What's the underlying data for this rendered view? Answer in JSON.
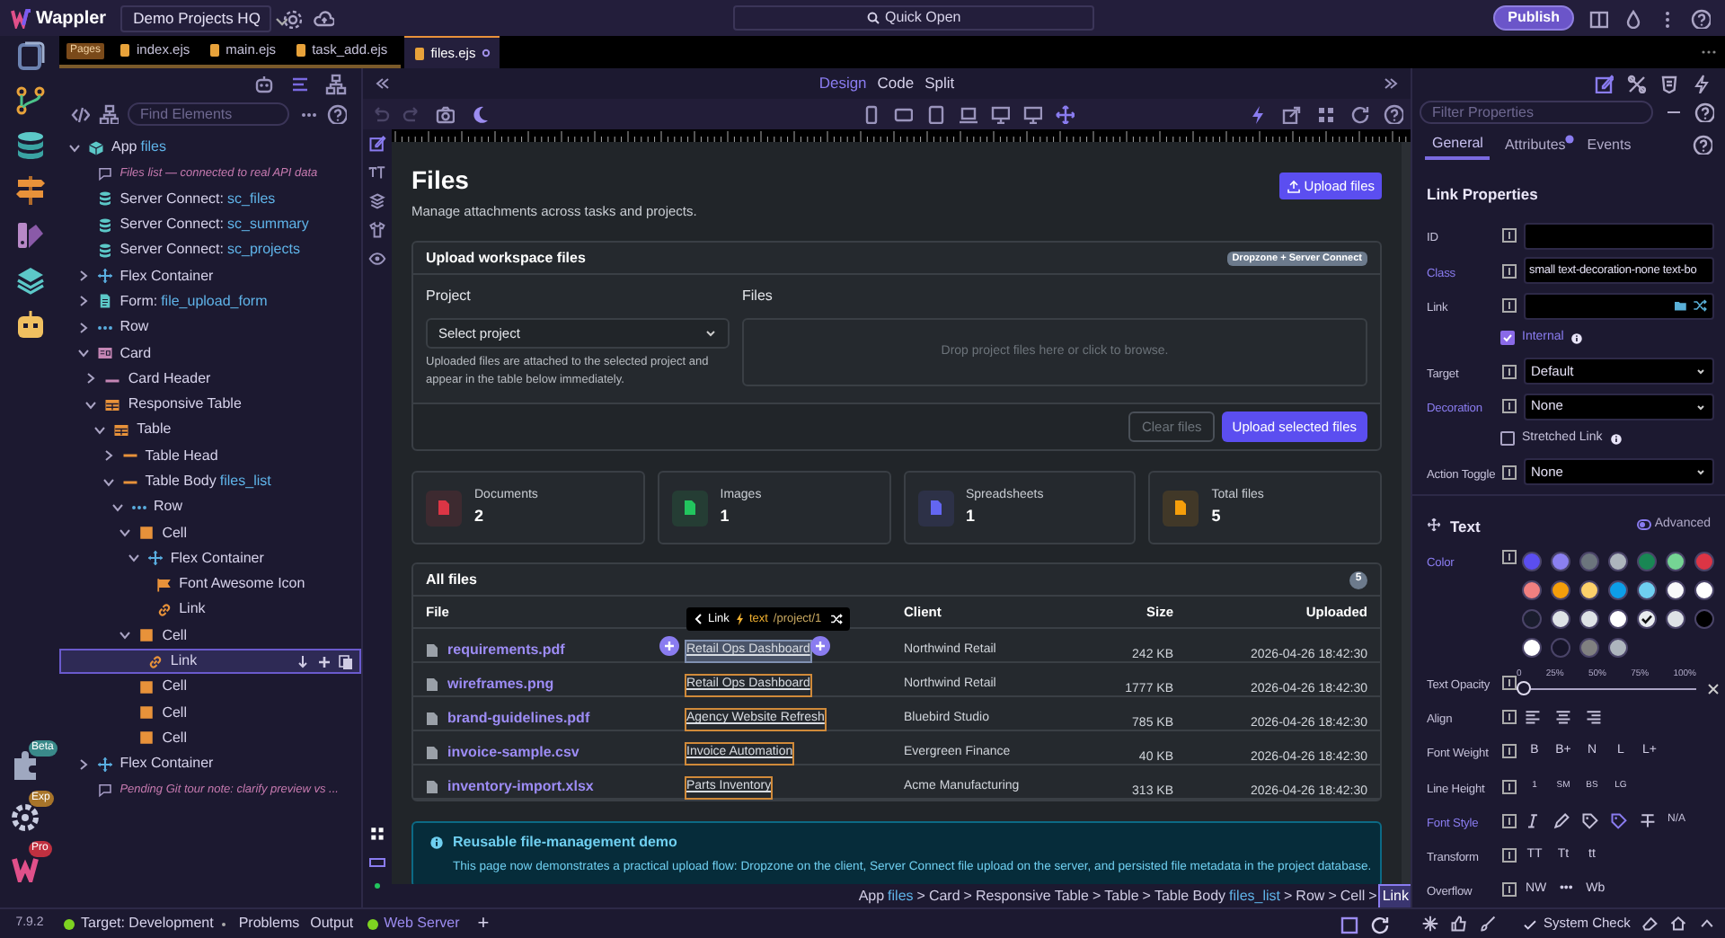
{
  "top_bar": {
    "app_name": "Wappler",
    "project": "Demo Projects HQ",
    "quick_open": "Quick Open",
    "publish": "Publish"
  },
  "file_tabs": {
    "pages_badge": "Pages",
    "tabs": [
      {
        "label": "index.ejs",
        "selected": false,
        "modified": false
      },
      {
        "label": "main.ejs",
        "selected": false,
        "modified": false
      },
      {
        "label": "task_add.ejs",
        "selected": false,
        "modified": false
      },
      {
        "label": "files.ejs",
        "selected": true,
        "modified": true
      }
    ]
  },
  "rail_badges": [
    "Beta",
    "Exp",
    "Pro"
  ],
  "structure": {
    "search": {
      "placeholder": "Find Elements"
    },
    "tree": [
      {
        "kind": "app",
        "label": "App",
        "ref": "files",
        "expanded": true,
        "selected": false,
        "children": [
          {
            "kind": "comment",
            "label": "Files list — connected to real API data",
            "selected": false
          },
          {
            "kind": "server",
            "label": "Server Connect:",
            "ref": "sc_files",
            "selected": false
          },
          {
            "kind": "server",
            "label": "Server Connect:",
            "ref": "sc_summary",
            "selected": false
          },
          {
            "kind": "server",
            "label": "Server Connect:",
            "ref": "sc_projects",
            "selected": false
          },
          {
            "kind": "flex",
            "label": "Flex Container",
            "expanded": false,
            "selected": false
          },
          {
            "kind": "form",
            "label": "Form:",
            "ref": "file_upload_form",
            "expanded": false,
            "selected": false
          },
          {
            "kind": "row",
            "label": "Row",
            "expanded": false,
            "selected": false
          },
          {
            "kind": "card",
            "label": "Card",
            "expanded": true,
            "selected": false,
            "children": [
              {
                "kind": "card-header",
                "label": "Card Header",
                "expanded": false,
                "selected": false
              },
              {
                "kind": "table",
                "label": "Responsive Table",
                "expanded": true,
                "selected": false,
                "children": [
                  {
                    "kind": "table",
                    "label": "Table",
                    "expanded": true,
                    "selected": false,
                    "children": [
                      {
                        "kind": "table-part",
                        "label": "Table Head",
                        "expanded": false,
                        "selected": false
                      },
                      {
                        "kind": "table-part",
                        "label": "Table Body",
                        "ref": "files_list",
                        "expanded": true,
                        "selected": false,
                        "children": [
                          {
                            "kind": "row",
                            "label": "Row",
                            "expanded": true,
                            "selected": false,
                            "children": [
                              {
                                "kind": "cell",
                                "label": "Cell",
                                "expanded": true,
                                "selected": false,
                                "children": [
                                  {
                                    "kind": "flex",
                                    "label": "Flex Container",
                                    "expanded": true,
                                    "selected": false,
                                    "children": [
                                      {
                                        "kind": "icon",
                                        "label": "Font Awesome Icon",
                                        "selected": false
                                      },
                                      {
                                        "kind": "link",
                                        "label": "Link",
                                        "selected": false
                                      }
                                    ]
                                  }
                                ]
                              },
                              {
                                "kind": "cell",
                                "label": "Cell",
                                "expanded": true,
                                "selected": false,
                                "children": [
                                  {
                                    "kind": "link",
                                    "label": "Link",
                                    "selected": true
                                  }
                                ]
                              },
                              {
                                "kind": "cell",
                                "label": "Cell",
                                "selected": false
                              },
                              {
                                "kind": "cell",
                                "label": "Cell",
                                "selected": false
                              },
                              {
                                "kind": "cell",
                                "label": "Cell",
                                "selected": false
                              }
                            ]
                          }
                        ]
                      }
                    ]
                  }
                ]
              }
            ]
          },
          {
            "kind": "flex",
            "label": "Flex Container",
            "expanded": false,
            "selected": false
          },
          {
            "kind": "comment",
            "label": "Pending Git tour note: clarify preview vs ...",
            "selected": false
          }
        ]
      }
    ]
  },
  "view_modes": [
    {
      "label": "Design",
      "selected": true
    },
    {
      "label": "Code",
      "selected": false
    },
    {
      "label": "Split",
      "selected": false
    }
  ],
  "page": {
    "title": "Files",
    "subtitle": "Manage attachments across tasks and projects.",
    "upload_button": "Upload files",
    "upload_card": {
      "title": "Upload workspace files",
      "badge": "Dropzone + Server Connect",
      "project_label": "Project",
      "project_select": "Select project",
      "help": "Uploaded files are attached to the selected project and appear in the table below immediately.",
      "files_label": "Files",
      "dropzone": "Drop project files here or click to browse.",
      "clear_button": "Clear files",
      "submit_button": "Upload selected files"
    },
    "stats": [
      {
        "label": "Documents",
        "value": "2",
        "color": "#dc3545"
      },
      {
        "label": "Images",
        "value": "1",
        "color": "#22c55e"
      },
      {
        "label": "Spreadsheets",
        "value": "1",
        "color": "#6366f1"
      },
      {
        "label": "Total files",
        "value": "5",
        "color": "#f59e0b"
      }
    ],
    "files_table": {
      "title": "All files",
      "count": "5",
      "columns": [
        "File",
        "",
        "Client",
        "Size",
        "Uploaded"
      ],
      "tooltip": {
        "label": "Link",
        "type": "text",
        "value": "/project/1"
      },
      "rows": [
        {
          "file": "requirements.pdf",
          "project": "Retail Ops Dashboard",
          "client": "Northwind Retail",
          "size": "242 KB",
          "uploaded": "2026-04-26 18:42:30",
          "selected": true
        },
        {
          "file": "wireframes.png",
          "project": "Retail Ops Dashboard",
          "client": "Northwind Retail",
          "size": "1777 KB",
          "uploaded": "2026-04-26 18:42:30",
          "selected": false
        },
        {
          "file": "brand-guidelines.pdf",
          "project": "Agency Website Refresh",
          "client": "Bluebird Studio",
          "size": "785 KB",
          "uploaded": "2026-04-26 18:42:30",
          "selected": false
        },
        {
          "file": "invoice-sample.csv",
          "project": "Invoice Automation",
          "client": "Evergreen Finance",
          "size": "40 KB",
          "uploaded": "2026-04-26 18:42:30",
          "selected": false
        },
        {
          "file": "inventory-import.xlsx",
          "project": "Parts Inventory",
          "client": "Acme Manufacturing",
          "size": "313 KB",
          "uploaded": "2026-04-26 18:42:30",
          "selected": false
        }
      ]
    },
    "alert": {
      "title": "Reusable file-management demo",
      "text": "This page now demonstrates a practical upload flow: Dropzone on the client, Server Connect file upload on the server, and persisted file metadata in the project database."
    }
  },
  "breadcrumb": [
    {
      "label": "App",
      "ref": "files",
      "selected": false
    },
    {
      "separator": ">",
      "label": "Card",
      "selected": false
    },
    {
      "separator": ">",
      "label": "Responsive Table",
      "selected": false
    },
    {
      "separator": ">",
      "label": "Table",
      "selected": false
    },
    {
      "separator": ">",
      "label": "Table Body",
      "ref": "files_list",
      "selected": false
    },
    {
      "separator": ">",
      "label": "Row",
      "selected": false
    },
    {
      "separator": ">",
      "label": "Cell",
      "selected": false
    },
    {
      "separator": ">",
      "label": "Link",
      "selected": true
    }
  ],
  "properties": {
    "filter": {
      "placeholder": "Filter Properties"
    },
    "tabs": [
      {
        "label": "General",
        "selected": true,
        "dot": false
      },
      {
        "label": "Attributes",
        "selected": false,
        "dot": true
      },
      {
        "label": "Events",
        "selected": false,
        "dot": false
      }
    ],
    "title": "Link Properties",
    "rows": [
      {
        "kind": "input",
        "label": "ID",
        "highlighted": false
      },
      {
        "kind": "input",
        "label": "Class",
        "value": "small text-decoration-none text-bo",
        "highlighted": true
      },
      {
        "kind": "link",
        "label": "Link",
        "highlighted": false
      },
      {
        "kind": "checkbox",
        "label": "Internal",
        "checked": true
      },
      {
        "kind": "select",
        "label": "Target",
        "value": "Default",
        "highlighted": false
      },
      {
        "kind": "select",
        "label": "Decoration",
        "value": "None",
        "highlighted": true
      },
      {
        "kind": "checkbox",
        "label": "Stretched Link",
        "checked": false
      },
      {
        "kind": "select",
        "label": "Action Toggle",
        "value": "None",
        "highlighted": false
      }
    ],
    "text_section": {
      "title": "Text",
      "advanced": "Advanced",
      "rows": [
        {
          "kind": "colors",
          "label": "Color",
          "highlighted": true,
          "swatches": [
            {
              "color": "#5b4ef0",
              "checked": false
            },
            {
              "color": "#8b80f0",
              "checked": false
            },
            {
              "color": "#6c757d",
              "checked": false
            },
            {
              "color": "#adb5bd",
              "checked": false
            },
            {
              "color": "#198754",
              "checked": false
            },
            {
              "color": "#75d494",
              "checked": false
            },
            {
              "color": "#dc3545",
              "checked": false
            },
            {
              "color": "#f08080",
              "checked": false
            },
            {
              "color": "#f59e0b",
              "checked": false
            },
            {
              "color": "#fcd06a",
              "checked": false
            },
            {
              "color": "#0d9ee8",
              "checked": false
            },
            {
              "color": "#6fcff0",
              "checked": false
            },
            {
              "color": "#f8f9fa",
              "checked": false
            },
            {
              "color": "#ffffff",
              "checked": false
            },
            {
              "color": "#1a1d2e",
              "checked": false
            },
            {
              "color": "#dee2e6",
              "checked": false
            },
            {
              "color": "#dee2e6",
              "checked": false
            },
            {
              "color": "#ffffff",
              "checked": false
            },
            {
              "color": "#e9ecef",
              "checked": true
            },
            {
              "color": "#dee2e6",
              "checked": false
            },
            {
              "color": "#000000",
              "checked": false
            },
            {
              "color": "#ffffff",
              "checked": false
            },
            {
              "color": "#17152a",
              "checked": false
            },
            {
              "color": "#808080",
              "checked": false
            },
            {
              "color": "#adb5bd",
              "checked": false
            }
          ]
        },
        {
          "kind": "slider",
          "label": "Text Opacity",
          "highlighted": false,
          "level": 0,
          "ticks": [
            "0",
            "25%",
            "50%",
            "75%",
            "100%"
          ]
        },
        {
          "kind": "align",
          "label": "Align",
          "highlighted": false
        },
        {
          "kind": "buttons",
          "label": "Font Weight",
          "highlighted": false,
          "options": [
            "B",
            "B+",
            "N",
            "L",
            "L+"
          ]
        },
        {
          "kind": "buttons",
          "label": "Line Height",
          "highlighted": false,
          "options": [
            "1",
            "SM",
            "BS",
            "LG"
          ],
          "small": true
        },
        {
          "kind": "styles",
          "label": "Font Style",
          "highlighted": true,
          "options": [
            {
              "kind": "italic",
              "selected": false
            },
            {
              "kind": "pen",
              "selected": false
            },
            {
              "kind": "tag",
              "selected": false
            },
            {
              "kind": "tag",
              "selected": true
            },
            {
              "kind": "strike",
              "selected": false
            },
            {
              "kind": "text",
              "label": "N/A",
              "selected": false
            }
          ]
        },
        {
          "kind": "buttons",
          "label": "Transform",
          "highlighted": false,
          "options": [
            "TT",
            "Tt",
            "tt"
          ]
        },
        {
          "kind": "buttons",
          "label": "Overflow",
          "highlighted": false,
          "options": [
            "NW",
            "•••",
            "Wb"
          ]
        }
      ]
    }
  },
  "status_bar": {
    "version": "7.9.2",
    "target": "Target: Development",
    "problems": "Problems",
    "output": "Output",
    "server": "Web Server",
    "add": "+",
    "system_check": "System Check"
  }
}
